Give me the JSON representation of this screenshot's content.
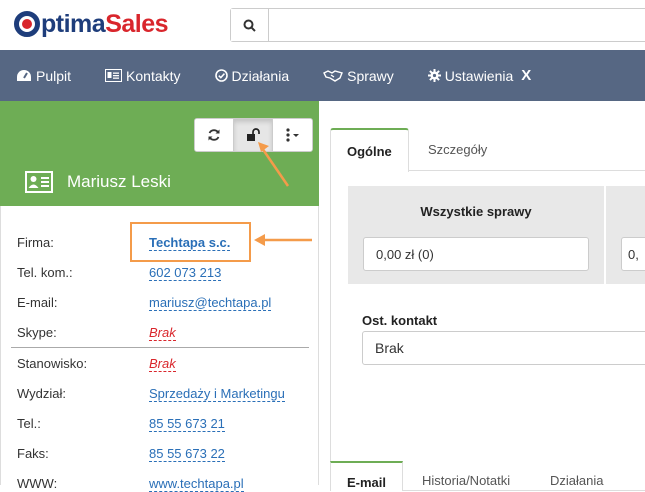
{
  "brand": {
    "name_part1": "ptima",
    "name_part2": "Sales"
  },
  "search": {
    "placeholder": ""
  },
  "nav": {
    "items": [
      {
        "label": "Pulpit",
        "icon": "dashboard-icon"
      },
      {
        "label": "Kontakty",
        "icon": "address-card-icon"
      },
      {
        "label": "Działania",
        "icon": "check-circle-icon"
      },
      {
        "label": "Sprawy",
        "icon": "handshake-icon"
      },
      {
        "label": "Ustawienia",
        "icon": "gear-icon"
      }
    ],
    "close_label": "X"
  },
  "contact": {
    "name": "Mariusz Leski",
    "fields": [
      {
        "label": "Firma:",
        "value": "Techtapa s.c."
      },
      {
        "label": "Tel. kom.:",
        "value": "602 073 213"
      },
      {
        "label": "E-mail:",
        "value": "mariusz@techtapa.pl"
      },
      {
        "label": "Skype:",
        "value": "Brak"
      },
      {
        "label": "Stanowisko:",
        "value": "Brak"
      },
      {
        "label": "Wydział:",
        "value": "Sprzedaży i Marketingu"
      },
      {
        "label": "Tel.:",
        "value": "85 55 673 21"
      },
      {
        "label": "Faks:",
        "value": "85 55 673 22"
      },
      {
        "label": "WWW:",
        "value": "www.techtapa.pl"
      }
    ]
  },
  "tabs": {
    "general": "Ogólne",
    "details": "Szczegóły"
  },
  "stats": {
    "title": "Wszystkie sprawy",
    "value": "0,00 zł (0)",
    "value2": "0,"
  },
  "last_contact": {
    "label": "Ost. kontakt",
    "value": "Brak"
  },
  "tabs_bottom": {
    "email": "E-mail",
    "history": "Historia/Notatki",
    "actions": "Działania"
  },
  "colors": {
    "green": "#6ead55",
    "nav": "#566783",
    "link": "#2a6fb7",
    "empty": "#d9262c",
    "annotation": "#f49b4a"
  }
}
